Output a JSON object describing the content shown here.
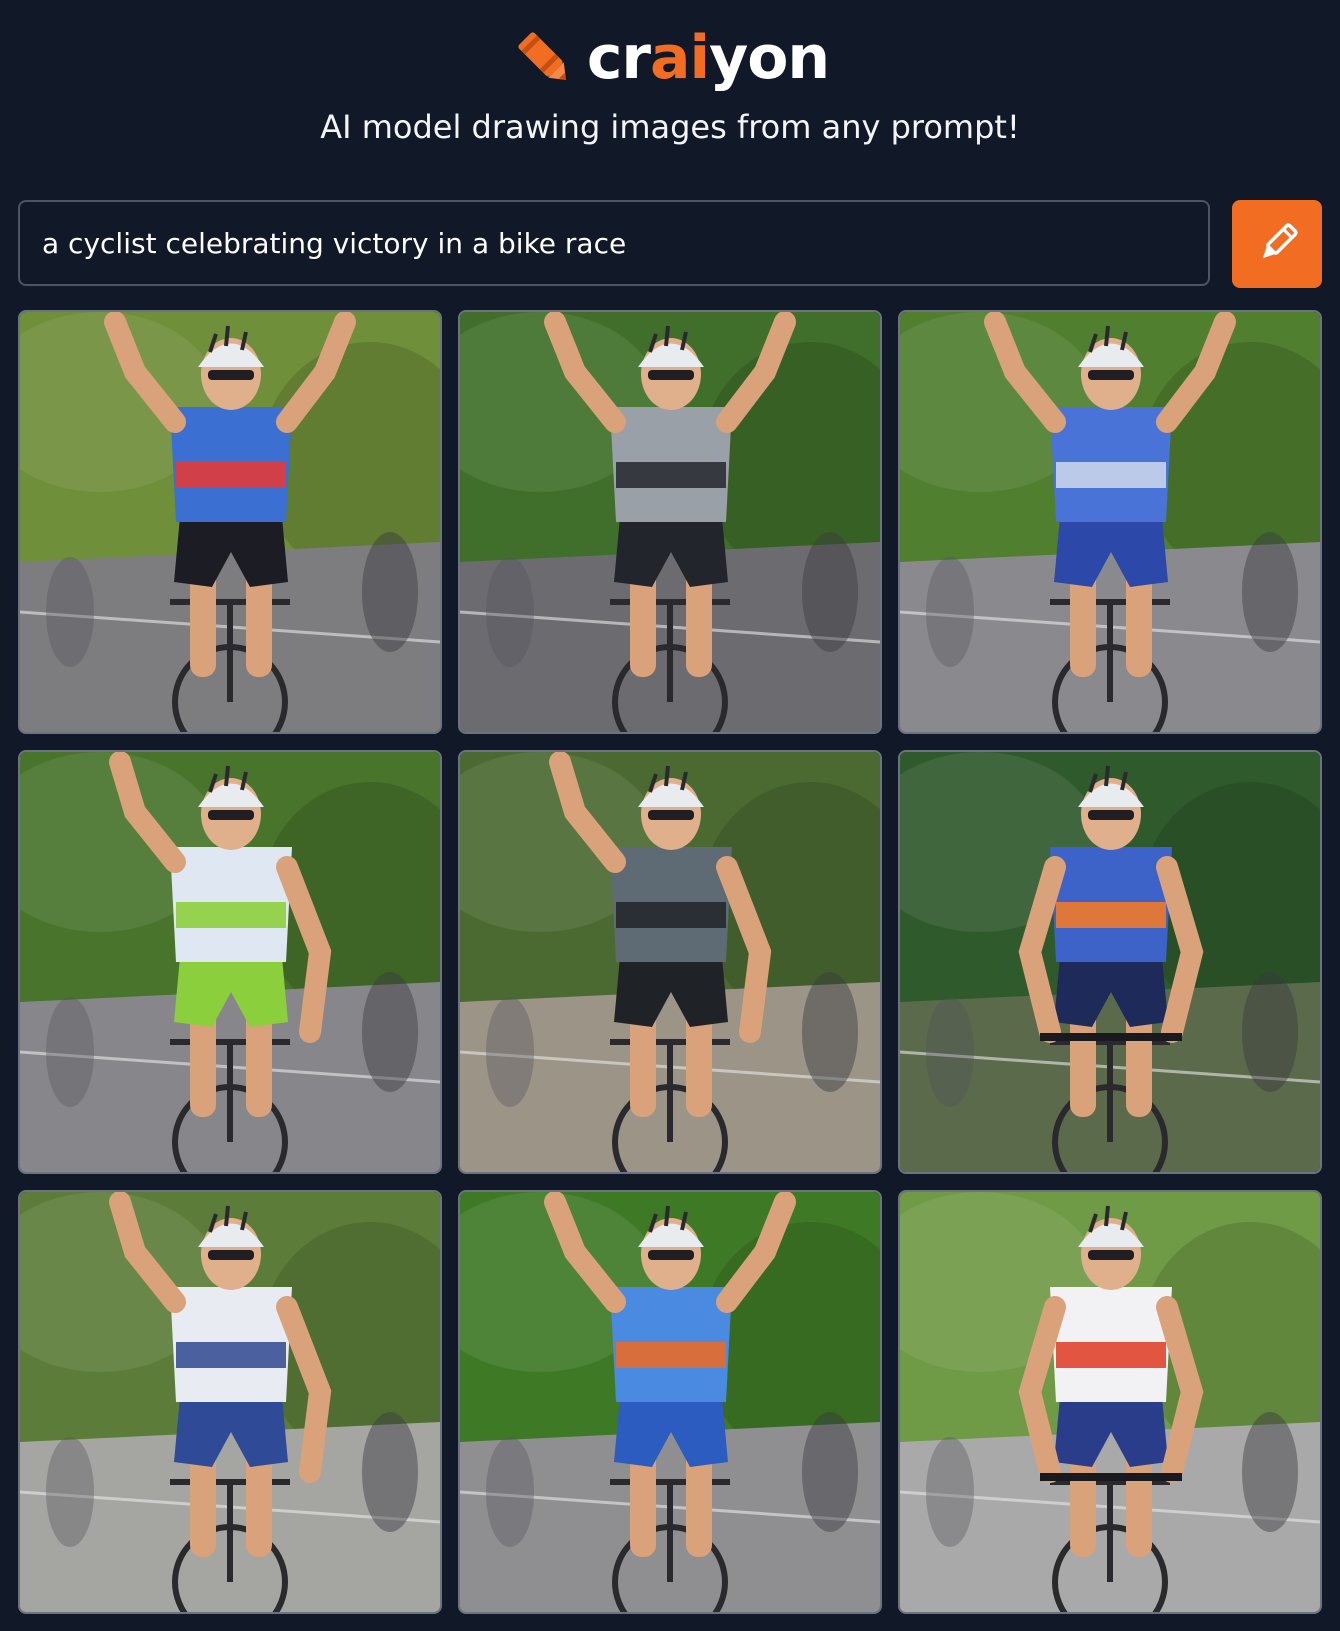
{
  "brand": {
    "prefix": "cr",
    "accent": "ai",
    "suffix": "yon",
    "accent_color": "#f26d21"
  },
  "header": {
    "tagline": "AI model drawing images from any prompt!"
  },
  "prompt": {
    "value": "a cyclist celebrating victory in a bike race",
    "button_icon": "pencil-icon",
    "button_color": "#f26d21"
  },
  "results": [
    {
      "pose": "arms-up",
      "jersey": "#3b6fd1",
      "jersey2": "#e23a3a",
      "shorts": "#1c1c24",
      "bg": "#6f8f3a",
      "road": "#7d7d80"
    },
    {
      "pose": "arms-up",
      "jersey": "#9aa0a8",
      "jersey2": "#2b2d33",
      "shorts": "#22252b",
      "bg": "#3f6f2a",
      "road": "#6c6c70"
    },
    {
      "pose": "arms-up",
      "jersey": "#4a73d8",
      "jersey2": "#c8d4ea",
      "shorts": "#2c48a8",
      "bg": "#4f7f2f",
      "road": "#8a8a8e"
    },
    {
      "pose": "one-arm",
      "jersey": "#dfe7f2",
      "jersey2": "#8ccf3d",
      "shorts": "#8ccf3d",
      "bg": "#48742c",
      "road": "#87878b"
    },
    {
      "pose": "one-arm",
      "jersey": "#5e6a74",
      "jersey2": "#25292e",
      "shorts": "#1f2226",
      "bg": "#4b6a32",
      "road": "#9b9487"
    },
    {
      "pose": "riding",
      "jersey": "#3d63c8",
      "jersey2": "#f07a2a",
      "shorts": "#1e2a5a",
      "bg": "#2f5a2c",
      "road": "#5a6a4a"
    },
    {
      "pose": "one-arm",
      "jersey": "#e8ebf2",
      "jersey2": "#3a5296",
      "shorts": "#2f4a96",
      "bg": "#5c7d3a",
      "road": "#a5a5a2"
    },
    {
      "pose": "arms-up",
      "jersey": "#4a8ae0",
      "jersey2": "#e86a2a",
      "shorts": "#2d5cc0",
      "bg": "#3e7a26",
      "road": "#8f8f92"
    },
    {
      "pose": "riding",
      "jersey": "#f2f2f5",
      "jersey2": "#e0442c",
      "shorts": "#2a3d8a",
      "bg": "#6f9a46",
      "road": "#a9a9aa"
    }
  ]
}
